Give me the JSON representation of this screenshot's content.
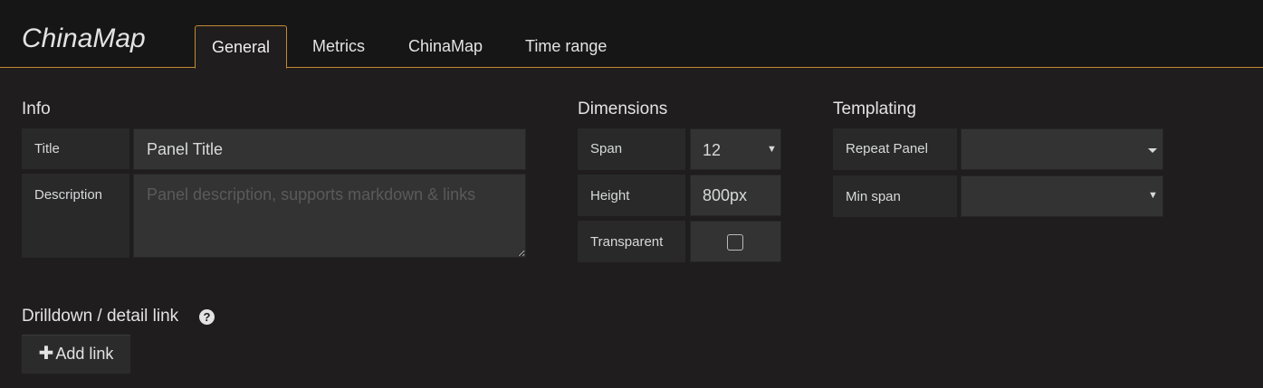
{
  "header": {
    "app_title": "ChinaMap",
    "tabs": [
      {
        "label": "General",
        "active": true
      },
      {
        "label": "Metrics",
        "active": false
      },
      {
        "label": "ChinaMap",
        "active": false
      },
      {
        "label": "Time range",
        "active": false
      }
    ]
  },
  "info": {
    "heading": "Info",
    "title_label": "Title",
    "title_value": "Panel Title",
    "description_label": "Description",
    "description_placeholder": "Panel description, supports markdown & links",
    "description_value": ""
  },
  "dimensions": {
    "heading": "Dimensions",
    "span_label": "Span",
    "span_value": "12",
    "height_label": "Height",
    "height_value": "800px",
    "transparent_label": "Transparent",
    "transparent_checked": false
  },
  "templating": {
    "heading": "Templating",
    "repeat_label": "Repeat Panel",
    "repeat_value": "",
    "minspan_label": "Min span",
    "minspan_value": ""
  },
  "drilldown": {
    "heading": "Drilldown / detail link",
    "help_glyph": "?",
    "add_link_plus": "✚",
    "add_link_label": "Add link"
  },
  "icons": {
    "dropdown_caret": "▼"
  },
  "colors": {
    "accent": "#c38a34",
    "background": "#1f1d1e",
    "header_bg": "#161616",
    "label_bg": "#292929",
    "field_bg": "#333333"
  }
}
